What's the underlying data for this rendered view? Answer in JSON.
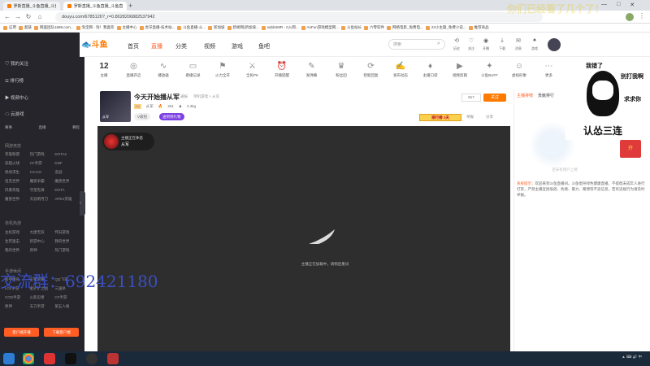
{
  "browser": {
    "tabs": [
      {
        "title": "罗斯直播_斗鱼直播_斗鱼直播",
        "active": false
      },
      {
        "title": "罗斯直播_斗鱼直播_斗鱼直播",
        "active": true
      }
    ],
    "url": "douyu.com/6785126?_r=0.8028206882537942",
    "bookmarks": [
      "应用",
      "超链",
      "网盛团队1688.com...",
      "淘宝网 - 淘！我喜欢",
      "主播中心",
      "虎牙直播-技术站...",
      "斗鱼直播-斗...",
      "新加坡",
      "新闻网(新加坡...",
      "sabkSMR - 0入网...",
      "AnFun游戏模型网...",
      "斗鱼站长",
      "六零软件",
      "网络电影_免费电...",
      "23小主题_免费小说...",
      "推荐商品"
    ]
  },
  "header": {
    "logo": "斗鱼",
    "nav": [
      {
        "label": "首页",
        "active": false
      },
      {
        "label": "直播",
        "active": true
      },
      {
        "label": "分类",
        "active": false
      },
      {
        "label": "视频",
        "active": false
      },
      {
        "label": "游戏",
        "active": false
      },
      {
        "label": "鱼吧",
        "active": false
      }
    ],
    "search_placeholder": "搜索",
    "icons": [
      {
        "label": "历史",
        "icon": "history-icon"
      },
      {
        "label": "关注",
        "icon": "heart-icon"
      },
      {
        "label": "开播",
        "icon": "camera-icon"
      },
      {
        "label": "下载",
        "icon": "download-icon"
      },
      {
        "label": "消息",
        "icon": "message-icon"
      },
      {
        "label": "游戏",
        "icon": "game-icon"
      }
    ]
  },
  "sidebar": {
    "items": [
      "我的关注",
      "排行榜",
      "视频中心",
      "云游戏"
    ],
    "icon_labels": [
      "赛事",
      "直播",
      "赛程"
    ],
    "section1": "网游竞技",
    "grid1": [
      "英雄联盟",
      "热门游戏",
      "DOTA2",
      "穿越火线",
      "CF手游",
      "DNF",
      "绝地求生",
      "CS:GO",
      "逆战",
      "坦克世界",
      "魔兽争霸",
      "魔兽世界",
      "风暴英雄",
      "守望先锋",
      "DOTA",
      "魔兽世界",
      "天涯明月刀",
      "APEX英雄"
    ],
    "section2": "单机热游",
    "grid2": [
      "主机游戏",
      "大唐无双",
      "怀旧游戏",
      "生死狙击",
      "新游中心",
      "我的世界",
      "我的世界",
      "原神",
      "热门游戏"
    ],
    "section3": "手游休闲",
    "grid3": [
      "和平精英",
      "王者荣耀",
      "QQ飞车",
      "LOL手游",
      "金铲铲之战",
      "三国杀",
      "COD手游",
      "火影忍者",
      "CF手游",
      "原神",
      "天刀手游",
      "第五人格"
    ],
    "btn_live": "客户端开播",
    "btn_download": "下载客户端"
  },
  "categories": [
    {
      "label": "主播",
      "value": "12",
      "sub": "兴趣"
    },
    {
      "label": "直播开启"
    },
    {
      "label": "播放器"
    },
    {
      "label": "看播记录"
    },
    {
      "label": "火力全开"
    },
    {
      "label": "全民PK"
    },
    {
      "label": "开播提醒"
    },
    {
      "label": "发弹幕"
    },
    {
      "label": "粉丝团"
    },
    {
      "label": "智能回复"
    },
    {
      "label": "发布动态"
    },
    {
      "label": "主播口袋"
    },
    {
      "label": "视频剪辑"
    },
    {
      "label": "斗鱼BUFF"
    },
    {
      "label": "虚拟形象"
    },
    {
      "label": "更多"
    }
  ],
  "room": {
    "title": "今天开始播从军",
    "tag": "通报",
    "category": "单机游戏 > 从军",
    "avatar_label": "从军",
    "level_badge": "V级别",
    "follow_label": "送到到礼物",
    "hot": "261",
    "fans": "2.4kg",
    "report": "举报",
    "share": "分享",
    "client": "客户端",
    "cp_label": "排行榜",
    "cp_value": "1天",
    "follow_btn": "关注",
    "follow_count": "817"
  },
  "video": {
    "loading_text": "主播正在加载中，请稍后重试",
    "anchor_name": "从军",
    "anchor_status": "主播正在休息"
  },
  "right_panel": {
    "tabs": [
      "主播排榜",
      "贡献排行"
    ],
    "notice_title": "系统提示：",
    "notice_text": "欢迎来到斗鱼直播间。斗鱼倡导绿色健康直播，不提倡未成年人进行打赏，严禁主播宣扬低俗、色情、暴力、赌博等不良信息，若有违规行为请及时举报。",
    "empty_text": "还未有用户上榜"
  },
  "meme": {
    "line1": "我错了",
    "line2": "别打我啊",
    "line3": "求求你",
    "line4": "认怂三连"
  },
  "overlay": {
    "watermark": "交流群：692421180",
    "top_right_text": "你们已经看了几个了！"
  }
}
